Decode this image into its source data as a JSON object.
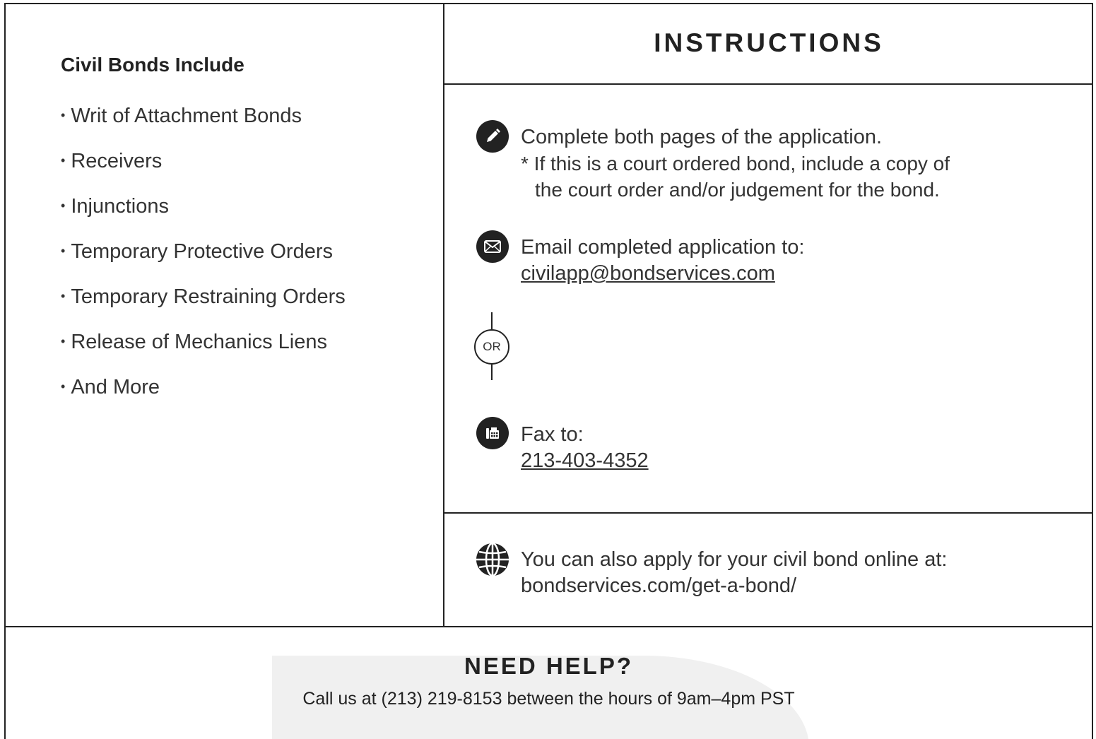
{
  "left_panel": {
    "title": "Civil Bonds Include",
    "items": [
      "Writ of Attachment Bonds",
      "Receivers",
      "Injunctions",
      "Temporary Protective Orders",
      "Temporary Restraining Orders",
      "Release of Mechanics Liens",
      "And More"
    ]
  },
  "instructions": {
    "title": "INSTRUCTIONS",
    "step1": {
      "icon": "pencil-icon",
      "line1": "Complete both pages of the application.",
      "line2": "* If this is a court ordered bond, include a copy of",
      "line3": "the court order and/or judgement for the bond."
    },
    "step2": {
      "icon": "envelope-icon",
      "label": "Email completed application to:",
      "email": "civilapp@bondservices.com"
    },
    "or_label": "OR",
    "step3": {
      "icon": "fax-icon",
      "label": "Fax to:",
      "fax": "213-403-4352"
    },
    "online": {
      "icon": "globe-icon",
      "label": "You can also apply for your civil bond online at:",
      "url": "bondservices.com/get-a-bond/"
    }
  },
  "help": {
    "title": "NEED HELP?",
    "text": "Call us at (213) 219-8153 between the hours of 9am–4pm PST"
  },
  "colors": {
    "ink": "#222222",
    "watermark": "#f0f0f0"
  }
}
